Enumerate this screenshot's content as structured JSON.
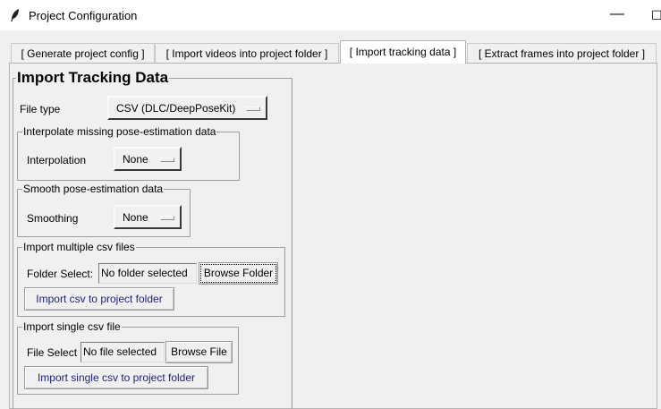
{
  "window": {
    "title": "Project Configuration",
    "minimize_glyph": "—",
    "maximize_glyph": "☐",
    "icon": "feather-icon"
  },
  "tabs": [
    {
      "label": "[ Generate project config ]"
    },
    {
      "label": "[ Import videos into project folder ]"
    },
    {
      "label": "[ Import tracking data ]"
    },
    {
      "label": "[ Extract frames into project folder ]"
    }
  ],
  "import_tracking": {
    "heading": "Import Tracking Data",
    "file_type_label": "File type",
    "file_type_value": "CSV (DLC/DeepPoseKit)",
    "interpolate": {
      "legend": "Interpolate missing pose-estimation data",
      "label": "Interpolation",
      "value": "None"
    },
    "smooth": {
      "legend": "Smooth pose-estimation data",
      "label": "Smoothing",
      "value": "None"
    },
    "multiple": {
      "legend": "Import multiple csv files",
      "folder_label": "Folder Select:",
      "folder_value": "No folder selected",
      "browse_label": "Browse Folder",
      "import_label": "Import csv to project folder"
    },
    "single": {
      "legend": "Import single csv file",
      "file_label": "File Select",
      "file_value": "No file selected",
      "browse_label": "Browse File",
      "import_label": "Import single csv to project folder"
    }
  },
  "colors": {
    "window_bg": "#f0f0f0",
    "titlebar_bg": "#ffffff",
    "button_text_accent": "#1e1e7a"
  }
}
